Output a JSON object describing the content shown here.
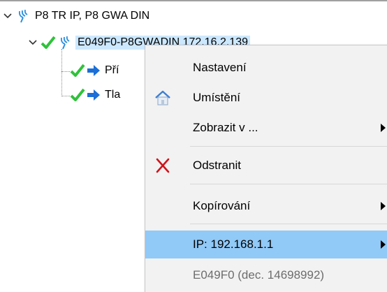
{
  "tree": {
    "root_label": "P8 TR IP, P8 GWA DIN",
    "device_label": "E049F0-P8GWADIN 172.16.2.139",
    "child1_label": "Pří",
    "child2_label": "Tla"
  },
  "context_menu": {
    "items": [
      {
        "label": "Nastavení"
      },
      {
        "label": "Umístění",
        "icon": "house-icon"
      },
      {
        "label": "Zobrazit v ...",
        "submenu": true
      },
      {
        "label": "Odstranit",
        "icon": "red-x-icon"
      },
      {
        "label": "Kopírování",
        "submenu": true
      },
      {
        "label": "IP: 192.168.1.1",
        "submenu": true,
        "highlighted": true
      },
      {
        "label": "E049F0 (dec. 14698992)",
        "disabled": true
      }
    ]
  },
  "colors": {
    "accent_highlight": "#91c9f7",
    "selection": "#cce8ff",
    "check_green": "#2fc23a",
    "arrow_blue": "#1c6fd6",
    "delete_red": "#d0131b"
  }
}
